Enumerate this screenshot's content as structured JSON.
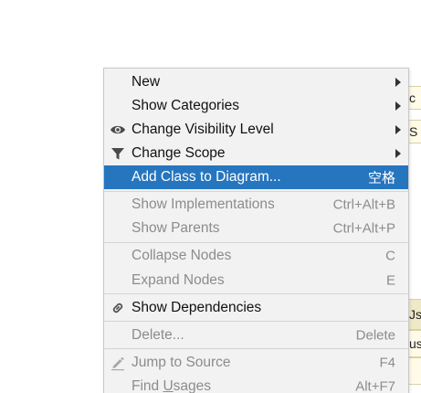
{
  "background_fragments": [
    "c",
    "S",
    "Js",
    "us"
  ],
  "menu": {
    "items": [
      {
        "label": "New",
        "shortcut": "",
        "submenu": true,
        "enabled": true
      },
      {
        "label": "Show Categories",
        "shortcut": "",
        "submenu": true,
        "enabled": true
      },
      {
        "label": "Change Visibility Level",
        "shortcut": "",
        "submenu": true,
        "enabled": true,
        "icon": "eye-icon"
      },
      {
        "label": "Change Scope",
        "shortcut": "",
        "submenu": true,
        "enabled": true,
        "icon": "filter-icon"
      },
      {
        "label": "Add Class to Diagram...",
        "shortcut": "空格",
        "submenu": false,
        "enabled": true,
        "selected": true
      },
      {
        "label": "Show Implementations",
        "shortcut": "Ctrl+Alt+B",
        "enabled": false
      },
      {
        "label": "Show Parents",
        "shortcut": "Ctrl+Alt+P",
        "enabled": false
      },
      {
        "label": "Collapse Nodes",
        "shortcut": "C",
        "enabled": false
      },
      {
        "label": "Expand Nodes",
        "shortcut": "E",
        "enabled": false
      },
      {
        "label": "Show Dependencies",
        "shortcut": "",
        "enabled": true,
        "icon": "link-icon"
      },
      {
        "label": "Delete...",
        "shortcut": "Delete",
        "enabled": false
      },
      {
        "label": "Jump to Source",
        "shortcut": "F4",
        "enabled": false,
        "icon": "pencil-icon"
      },
      {
        "label_pre": "Find ",
        "label_u": "U",
        "label_post": "sages",
        "shortcut": "Alt+F7",
        "enabled": false
      }
    ]
  },
  "colors": {
    "menu_background": "#f2f2f2",
    "selection": "#2675bf",
    "disabled_text": "#8c8c8c",
    "separator": "#d4d4d4"
  }
}
